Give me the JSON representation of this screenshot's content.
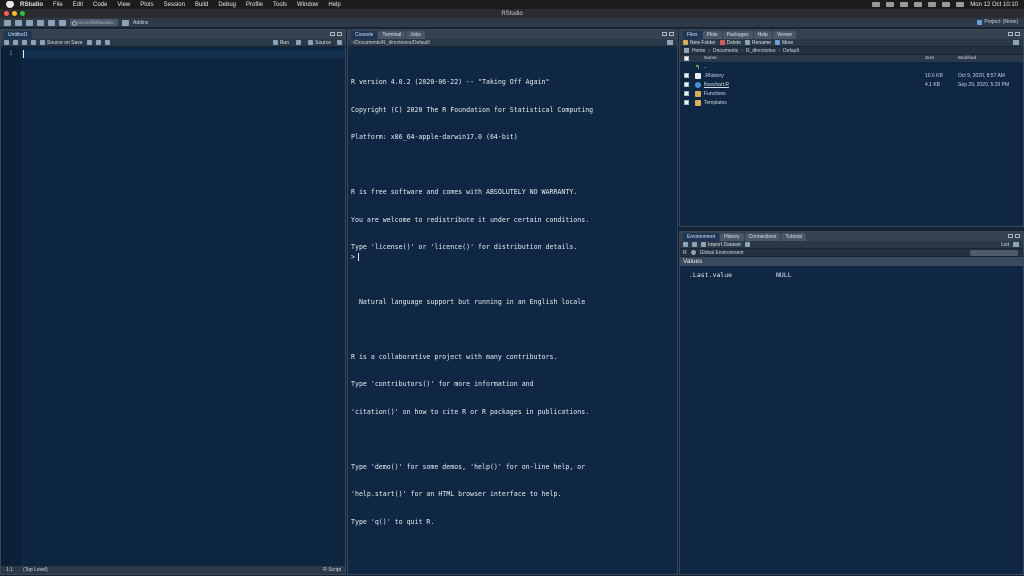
{
  "menubar": {
    "app": "RStudio",
    "items": [
      "File",
      "Edit",
      "Code",
      "View",
      "Plots",
      "Session",
      "Build",
      "Debug",
      "Profile",
      "Tools",
      "Window",
      "Help"
    ],
    "clock": "Mon 12 Oct  10:10"
  },
  "window": {
    "title": "RStudio"
  },
  "toolbar": {
    "goto_placeholder": "Go to file/function",
    "addins_label": "Addins",
    "project_label": "Project: (None)"
  },
  "source": {
    "tab": "Untitled1",
    "source_on_save": "Source on Save",
    "run_label": "Run",
    "source_label": "Source",
    "line_number": "1",
    "status_pos": "1:1",
    "status_scope": "(Top Level)",
    "status_type": "R Script"
  },
  "console": {
    "tabs": [
      "Console",
      "Terminal",
      "Jobs"
    ],
    "path": "~/Documents/R_directories/Default/",
    "lines": [
      "R version 4.0.2 (2020-06-22) -- \"Taking Off Again\"",
      "Copyright (C) 2020 The R Foundation for Statistical Computing",
      "Platform: x86_64-apple-darwin17.0 (64-bit)",
      "",
      "R is free software and comes with ABSOLUTELY NO WARRANTY.",
      "You are welcome to redistribute it under certain conditions.",
      "Type 'license()' or 'licence()' for distribution details.",
      "",
      "  Natural language support but running in an English locale",
      "",
      "R is a collaborative project with many contributors.",
      "Type 'contributors()' for more information and",
      "'citation()' on how to cite R or R packages in publications.",
      "",
      "Type 'demo()' for some demos, 'help()' for on-line help, or",
      "'help.start()' for an HTML browser interface to help.",
      "Type 'q()' to quit R."
    ],
    "prompt": ">"
  },
  "files": {
    "tabs": [
      "Files",
      "Plots",
      "Packages",
      "Help",
      "Viewer"
    ],
    "new_folder": "New Folder",
    "delete": "Delete",
    "rename": "Rename",
    "more": "More",
    "crumbs": [
      "Home",
      "Documents",
      "R_directories",
      "Default"
    ],
    "headers": {
      "name": "Name",
      "size": "Size",
      "modified": "Modified"
    },
    "up_label": "..",
    "rows": [
      {
        "name": ".Rhistory",
        "size": "10.6 KB",
        "modified": "Oct 9, 2020, 8:57 AM",
        "icon": "file-icon"
      },
      {
        "name": "flowchart.R",
        "size": "4.1 KB",
        "modified": "Sep 29, 2020, 5:29 PM",
        "icon": "r-file-icon"
      },
      {
        "name": "Functions",
        "size": "",
        "modified": "",
        "icon": "folder-icon"
      },
      {
        "name": "Templates",
        "size": "",
        "modified": "",
        "icon": "folder-icon"
      }
    ]
  },
  "env": {
    "tabs": [
      "Environment",
      "History",
      "Connections",
      "Tutorial"
    ],
    "import_label": "Import Dataset",
    "list_label": "List",
    "lang": "R",
    "scope": "Global Environment",
    "section": "Values",
    "var_name": ".Last.value",
    "var_value": "NULL"
  }
}
